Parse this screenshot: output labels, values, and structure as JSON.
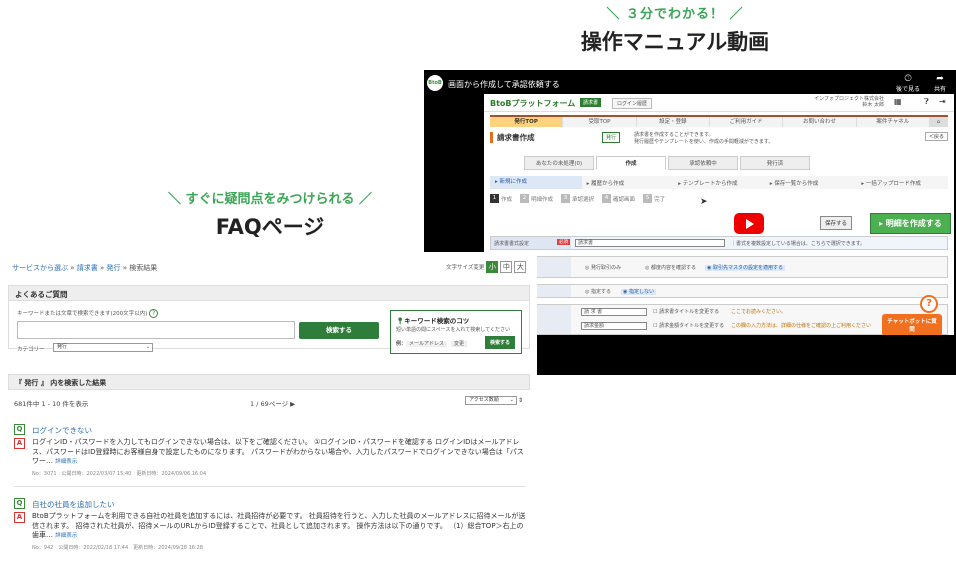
{
  "captions": {
    "video_sub": "＼ ３分でわかる！ ／",
    "video_title": "操作マニュアル動画",
    "faq_sub": "＼ すぐに疑問点をみつけられる ／",
    "faq_title": "FAQページ"
  },
  "colors": {
    "accent_green": "#3aa655",
    "youtube_red": "#e00000",
    "chat_orange": "#f07020"
  },
  "video": {
    "title": "画面から作成して承認依頼する",
    "logo_icon": "BtoB",
    "watch_later": "後で見る",
    "share": "共有",
    "header": {
      "brand": "BtoBプラットフォーム",
      "product": "請求書",
      "login_history": "ログイン履歴",
      "company": "インフォプロジェクト株式会社",
      "user": "鈴木 太郎"
    },
    "nav": [
      "発行TOP",
      "受取TOP",
      "設定・登録",
      "ご利用ガイド",
      "お問い合わせ",
      "案件チャネル"
    ],
    "page_title": "請求書作成",
    "badge": "発行",
    "desc_line1": "請求書を作成することができます。",
    "desc_line2": "発行履歴やテンプレートを使い、作成の手間軽減ができます。",
    "back": "＜戻る",
    "tabs": [
      "あなたの未処理(0)",
      "作成",
      "承認依頼中",
      "発行済"
    ],
    "subtabs": [
      "▸ 新規に作成",
      "▸ 履歴から作成",
      "▸ テンプレートから作成",
      "▸ 保存一覧から作成",
      "▸ 一括アップロード作成"
    ],
    "steps": [
      "作成",
      "明細作成",
      "承認選択",
      "確認画面",
      "完了"
    ],
    "save": "保存する",
    "make": "▸ 明細を作成する",
    "form": {
      "label1": "請求書書式設定",
      "required": "必須",
      "select1": "請求書",
      "note1": "｜書式を複数設定している場合は、こちらで選択できます。",
      "opt1": "◎ 発行取引のみ",
      "opt2": "◎ 都度内容を確認する",
      "opt3": "◉ 取引先マスタの設定を適用する",
      "opt4": "◎ 指定する",
      "opt5": "◉ 指定しない",
      "field1": "請 求 書",
      "field2": "請求金額",
      "chk1": "☐ 請求書タイトルを変更する",
      "chk2": "☐ 請求金額タイトルを変更する",
      "link1": "ここでお読みください。",
      "link2": "この欄の入力方法は、詳細の仕様をご確認の上ご利用ください"
    },
    "chat": "チャットボットに質問",
    "help": "?"
  },
  "faq": {
    "breadcrumb": [
      "サービスから選ぶ",
      "請求書",
      "発行",
      "検索結果"
    ],
    "font_size_label": "文字サイズ変更",
    "font_sizes": [
      "小",
      "中",
      "大"
    ],
    "panel_title": "よくあるご質問",
    "search_label": "キーワードまたは文章で検索できます(200文字以内)",
    "search_button": "検索する",
    "category_label": "カテゴリー",
    "category_value": "発行",
    "tips_title": "キーワード検索のコツ",
    "tips_desc": "短い単語の間にスペースを入れて検索してください",
    "tips_example_label": "例：",
    "tips_example1": "メールアドレス",
    "tips_example2": "変更",
    "tips_button": "検索する",
    "results_title": "『 発行 』 内を検索した結果",
    "results_count": "681件中 1 - 10 件を表示",
    "page": "1 / 69ページ ▶",
    "sort": "アクセス数順",
    "items": [
      {
        "q": "ログインできない",
        "a": "ログインID・パスワードを入力してもログインできない場合は、以下をご確認ください。 ①ログインID・パスワードを確認する ログインIDはメールアドレス、パスワードはID登録時にお客様自身で設定したものになります。 パスワードがわからない場合や、入力したパスワードでログインできない場合は「パスワー…",
        "more": "詳細表示",
        "meta": "No：3071　公開日時：2022/03/07 15:40　更新日時：2024/09/06 16:04"
      },
      {
        "q": "自社の社員を追加したい",
        "a": "BtoBプラットフォームを利用できる自社の社員を追加するには、社員招待が必要です。 社員招待を行うと、入力した社員のメールアドレスに招待メールが送信されます。 招待された社員が、招待メールのURLからID登録することで、社員として追加されます。 操作方法は以下の通りです。 （1）総合TOP＞右上の歯車…",
        "more": "詳細表示",
        "meta": "No：942　公開日時：2022/02/18 17:44　更新日時：2024/09/18 16:28"
      }
    ]
  }
}
